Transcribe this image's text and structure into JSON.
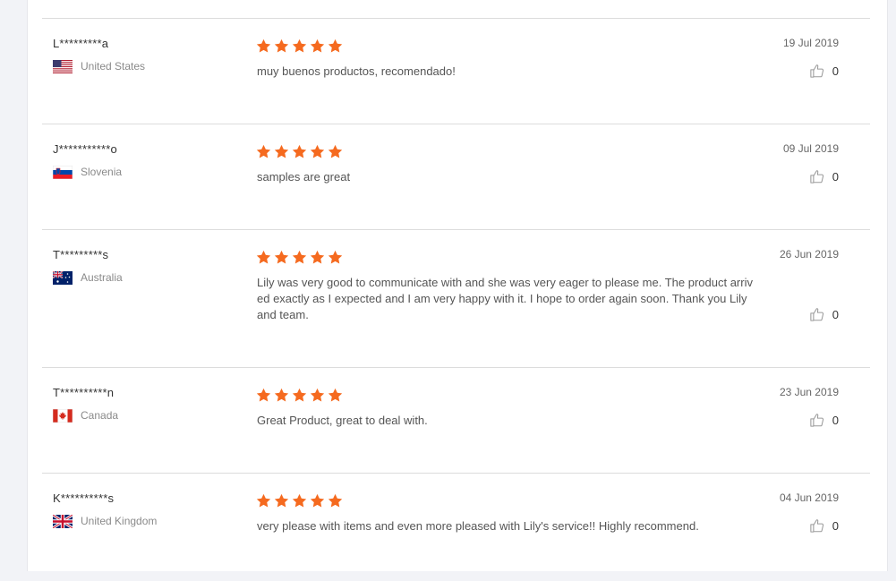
{
  "reviews": [
    {
      "name": "L*********a",
      "country": "United States",
      "flag": "us",
      "stars": 5,
      "text": "muy buenos productos, recomendado!",
      "date": "19 Jul 2019",
      "helpful": "0"
    },
    {
      "name": "J***********o",
      "country": "Slovenia",
      "flag": "si",
      "stars": 5,
      "text": "samples are great",
      "date": "09 Jul 2019",
      "helpful": "0"
    },
    {
      "name": "T*********s",
      "country": "Australia",
      "flag": "au",
      "stars": 5,
      "text": "Lily was very good to communicate with and she was very eager to please me.  The product arrived exactly as I expected and I am very happy with it. I hope to order again soon.  Thank you Lily and team.",
      "date": "26 Jun 2019",
      "helpful": "0"
    },
    {
      "name": "T**********n",
      "country": "Canada",
      "flag": "ca",
      "stars": 5,
      "text": "Great Product, great to deal with.",
      "date": "23 Jun 2019",
      "helpful": "0"
    },
    {
      "name": "K**********s",
      "country": "United Kingdom",
      "flag": "gb",
      "stars": 5,
      "text": "very please with items and even more pleased with Lily's service!! Highly recommend.",
      "date": "04 Jun 2019",
      "helpful": "0"
    }
  ],
  "colors": {
    "star": "#f56a1f",
    "divider": "#dcdcdc",
    "background": "#f2f3f7"
  }
}
